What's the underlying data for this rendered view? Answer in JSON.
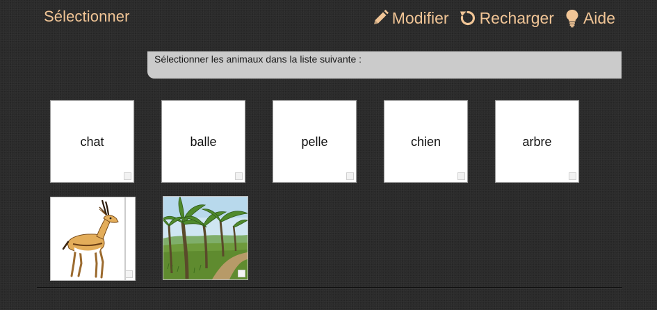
{
  "header": {
    "title": "Sélectionner",
    "actions": [
      {
        "label": "Modifier",
        "icon": "pencil-icon"
      },
      {
        "label": "Recharger",
        "icon": "reload-icon"
      },
      {
        "label": "Aide",
        "icon": "lightbulb-icon"
      }
    ]
  },
  "instruction": "Sélectionner les animaux dans la liste suivante :",
  "word_cards": [
    {
      "label": "chat",
      "selected": false
    },
    {
      "label": "balle",
      "selected": false
    },
    {
      "label": "pelle",
      "selected": false
    },
    {
      "label": "chien",
      "selected": false
    },
    {
      "label": "arbre",
      "selected": false
    }
  ],
  "image_cards": [
    {
      "picture": "gazelle-image",
      "selected": false
    },
    {
      "picture": "palm-forest-image",
      "selected": false
    }
  ],
  "colors": {
    "accent": "#f1c596",
    "background": "#2b2b2b",
    "instruction_bg": "#cbcbcb"
  }
}
